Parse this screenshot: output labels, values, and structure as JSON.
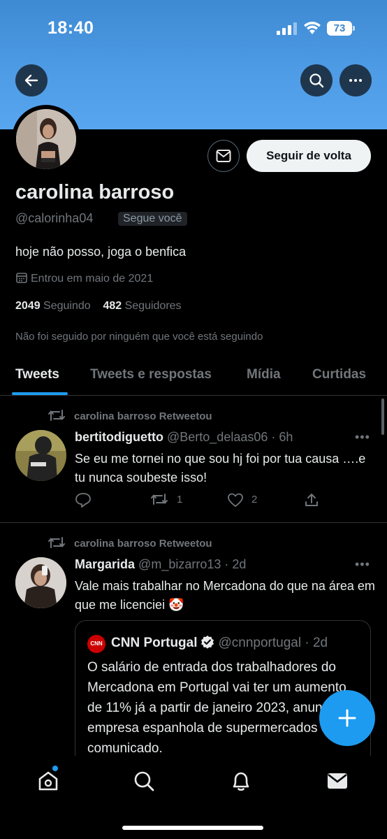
{
  "status_bar": {
    "time": "18:40",
    "battery": "73"
  },
  "profile": {
    "display_name": "carolina barroso",
    "handle": "@calorinha04",
    "follows_you_badge": "Segue você",
    "bio": "hoje não posso, joga o benfica",
    "joined": "Entrou em maio de 2021",
    "following_count": "2049",
    "following_label": "Seguindo",
    "followers_count": "482",
    "followers_label": "Seguidores",
    "mutual_note": "Não foi seguido por ninguém que você está seguindo",
    "follow_back_label": "Seguir de volta"
  },
  "tabs": [
    {
      "label": "Tweets",
      "active": true
    },
    {
      "label": "Tweets e respostas",
      "active": false
    },
    {
      "label": "Mídia",
      "active": false
    },
    {
      "label": "Curtidas",
      "active": false
    }
  ],
  "tweets": [
    {
      "retweet_label": "carolina barroso Retweetou",
      "name": "bertitodiguetto",
      "handle_time": "@Berto_delaas06 · 6h",
      "text": "Se eu me tornei no que sou hj foi por tua causa ….e tu nunca soubeste isso!",
      "retweets": "1",
      "likes": "2"
    },
    {
      "retweet_label": "carolina barroso Retweetou",
      "name": "Margarida",
      "handle_time": "@m_bizarro13 · 2d",
      "text": "Vale mais trabalhar no Mercadona do que na área em que me licenciei 🤡",
      "quote": {
        "logo_text": "CNN",
        "name": "CNN Portugal",
        "handle_time": "@cnnportugal · 2d",
        "text": "O salário de entrada dos trabalhadores do Mercadona em Portugal vai ter um aumento de 11% já a partir de janeiro 2023, anunciou a empresa espanhola de supermercados em comunicado."
      }
    }
  ],
  "colors": {
    "accent": "#1d9bf0",
    "banner": "#4e9be6",
    "background": "#000000"
  },
  "icons": [
    "back-arrow-icon",
    "search-icon",
    "more-icon",
    "message-icon",
    "calendar-icon",
    "retweet-icon",
    "reply-icon",
    "like-icon",
    "share-icon",
    "verified-icon",
    "compose-icon",
    "home-icon",
    "notifications-icon",
    "messages-icon"
  ]
}
